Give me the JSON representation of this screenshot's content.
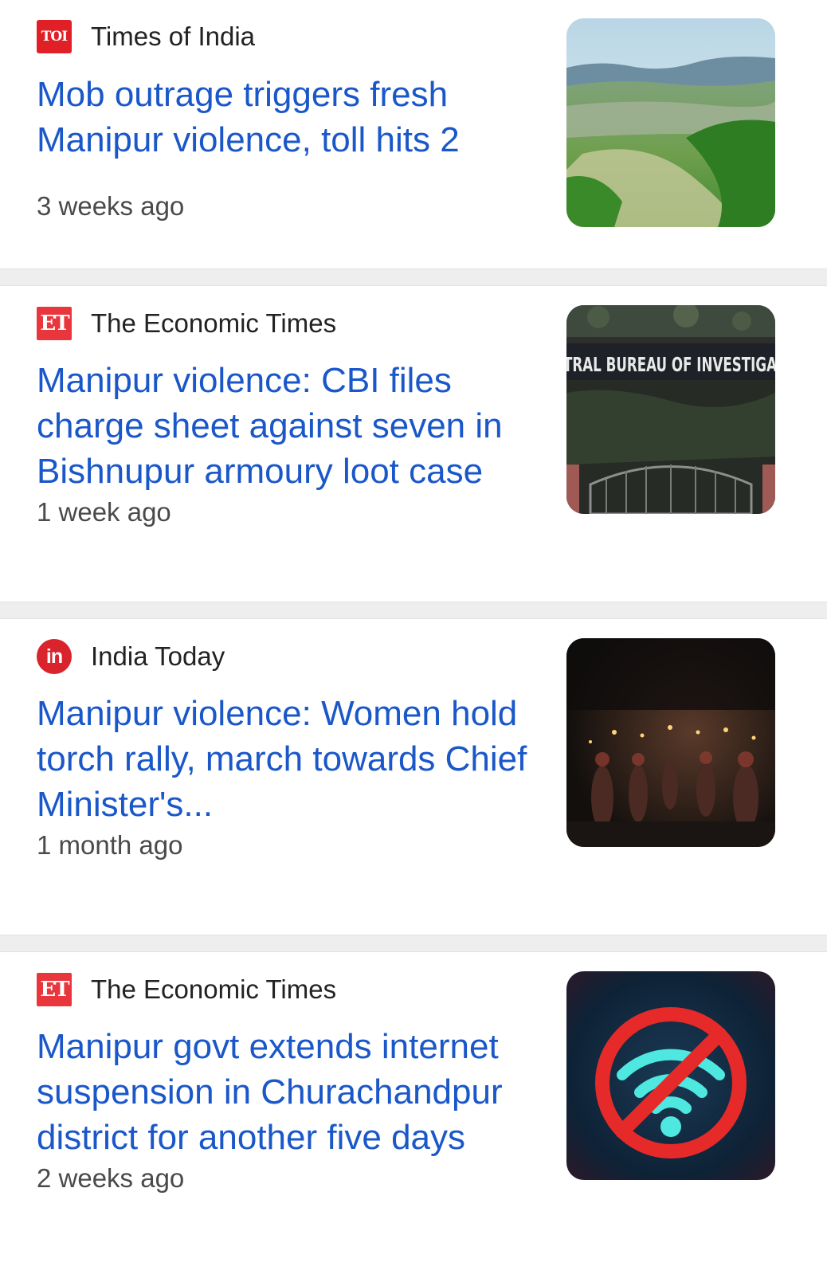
{
  "articles": [
    {
      "source": "Times of India",
      "logo_text": "TOI",
      "headline": "Mob outrage triggers fresh Manipur violence, toll hits 2",
      "time": "3 weeks ago",
      "thumbnail": "valley-landscape-photo"
    },
    {
      "source": "The Economic Times",
      "logo_text": "ET",
      "headline": "Manipur violence: CBI files charge sheet against seven in Bishnupur armoury loot case",
      "time": "1 week ago",
      "thumbnail": "cbi-building-gate-photo",
      "thumbnail_text": "TRAL BUREAU OF INVESTIGA"
    },
    {
      "source": "India Today",
      "logo_text": "in",
      "headline": "Manipur violence: Women hold torch rally, march towards Chief Minister's...",
      "time": "1 month ago",
      "thumbnail": "night-torch-rally-photo"
    },
    {
      "source": "The Economic Times",
      "logo_text": "ET",
      "headline": "Manipur govt extends internet suspension in Churachandpur district for another five days",
      "time": "2 weeks ago",
      "thumbnail": "no-wifi-sign-image"
    }
  ],
  "colors": {
    "headline": "#1a57c9",
    "source": "#222222",
    "time": "#4a4a4a",
    "divider": "#eeeeee",
    "toi_logo": "#e01f26",
    "et_logo": "#e8363c",
    "india_today_logo": "#d9232d"
  }
}
